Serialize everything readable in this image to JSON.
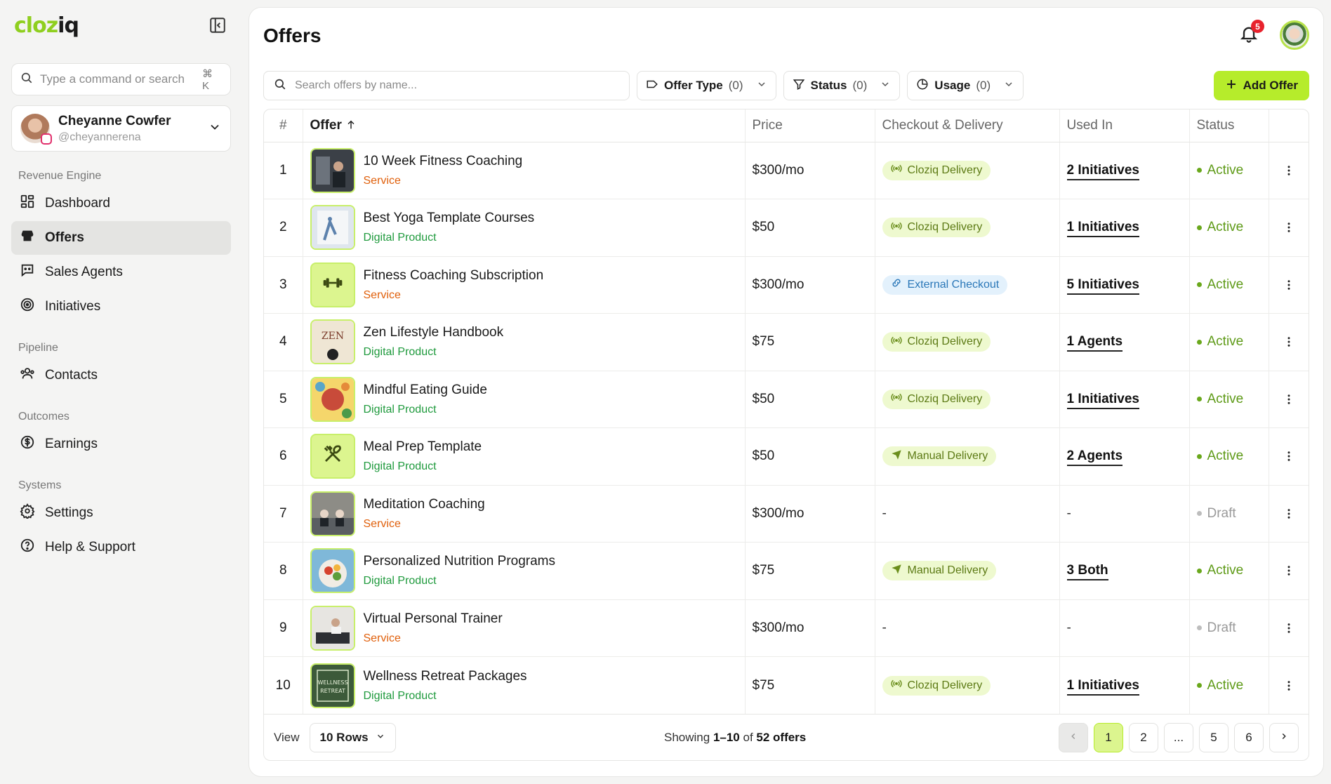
{
  "brand": {
    "logo": "cloziq"
  },
  "command_search": {
    "placeholder": "Type a command or search",
    "shortcut": "⌘ K"
  },
  "profile": {
    "name": "Cheyanne Cowfer",
    "handle": "@cheyannerena"
  },
  "nav": [
    {
      "section": "Revenue Engine",
      "items": [
        {
          "label": "Dashboard",
          "icon": "dashboard-icon"
        },
        {
          "label": "Offers",
          "icon": "store-icon",
          "active": true
        },
        {
          "label": "Sales Agents",
          "icon": "chat-agent-icon"
        },
        {
          "label": "Initiatives",
          "icon": "target-icon"
        }
      ]
    },
    {
      "section": "Pipeline",
      "items": [
        {
          "label": "Contacts",
          "icon": "users-icon"
        }
      ]
    },
    {
      "section": "Outcomes",
      "items": [
        {
          "label": "Earnings",
          "icon": "dollar-icon"
        }
      ]
    },
    {
      "section": "Systems",
      "items": [
        {
          "label": "Settings",
          "icon": "gear-icon"
        },
        {
          "label": "Help & Support",
          "icon": "help-icon"
        }
      ]
    }
  ],
  "header": {
    "title": "Offers",
    "notification_count": "5"
  },
  "filters": {
    "search_placeholder": "Search offers by name...",
    "offer_type": {
      "label": "Offer Type",
      "count": "(0)"
    },
    "status": {
      "label": "Status",
      "count": "(0)"
    },
    "usage": {
      "label": "Usage",
      "count": "(0)"
    },
    "add_label": "Add Offer"
  },
  "table": {
    "headers": {
      "num": "#",
      "offer": "Offer",
      "price": "Price",
      "checkout": "Checkout & Delivery",
      "used_in": "Used In",
      "status": "Status"
    },
    "rows": [
      {
        "n": "1",
        "name": "10 Week Fitness Coaching",
        "type": "Service",
        "price": "$300/mo",
        "delivery": "Cloziq Delivery",
        "used": "2 Initiatives",
        "status": "Active"
      },
      {
        "n": "2",
        "name": "Best Yoga Template Courses",
        "type": "Digital Product",
        "price": "$50",
        "delivery": "Cloziq Delivery",
        "used": "1 Initiatives",
        "status": "Active"
      },
      {
        "n": "3",
        "name": "Fitness Coaching Subscription",
        "type": "Service",
        "price": "$300/mo",
        "delivery": "External Checkout",
        "used": "5 Initiatives",
        "status": "Active"
      },
      {
        "n": "4",
        "name": "Zen Lifestyle Handbook",
        "type": "Digital Product",
        "price": "$75",
        "delivery": "Cloziq Delivery",
        "used": "1 Agents",
        "status": "Active"
      },
      {
        "n": "5",
        "name": "Mindful Eating Guide",
        "type": "Digital Product",
        "price": "$50",
        "delivery": "Cloziq Delivery",
        "used": "1 Initiatives",
        "status": "Active"
      },
      {
        "n": "6",
        "name": "Meal Prep Template",
        "type": "Digital Product",
        "price": "$50",
        "delivery": "Manual Delivery",
        "used": "2 Agents",
        "status": "Active"
      },
      {
        "n": "7",
        "name": "Meditation Coaching",
        "type": "Service",
        "price": "$300/mo",
        "delivery": "-",
        "used": "-",
        "status": "Draft"
      },
      {
        "n": "8",
        "name": "Personalized Nutrition Programs",
        "type": "Digital Product",
        "price": "$75",
        "delivery": "Manual Delivery",
        "used": "3 Both",
        "status": "Active"
      },
      {
        "n": "9",
        "name": "Virtual Personal Trainer",
        "type": "Service",
        "price": "$300/mo",
        "delivery": "-",
        "used": "-",
        "status": "Draft"
      },
      {
        "n": "10",
        "name": "Wellness Retreat Packages",
        "type": "Digital Product",
        "price": "$75",
        "delivery": "Cloziq Delivery",
        "used": "1 Initiatives",
        "status": "Active"
      }
    ]
  },
  "footer": {
    "view_label": "View",
    "rows_label": "10 Rows",
    "showing_prefix": "Showing ",
    "showing_range": "1–10",
    "showing_mid": " of ",
    "showing_total": "52 offers",
    "pages": [
      "1",
      "2",
      "...",
      "5",
      "6"
    ]
  },
  "colors": {
    "accent": "#b6ec2b",
    "service": "#e0600c",
    "digital": "#1f9a3d",
    "active": "#5e9a17"
  }
}
